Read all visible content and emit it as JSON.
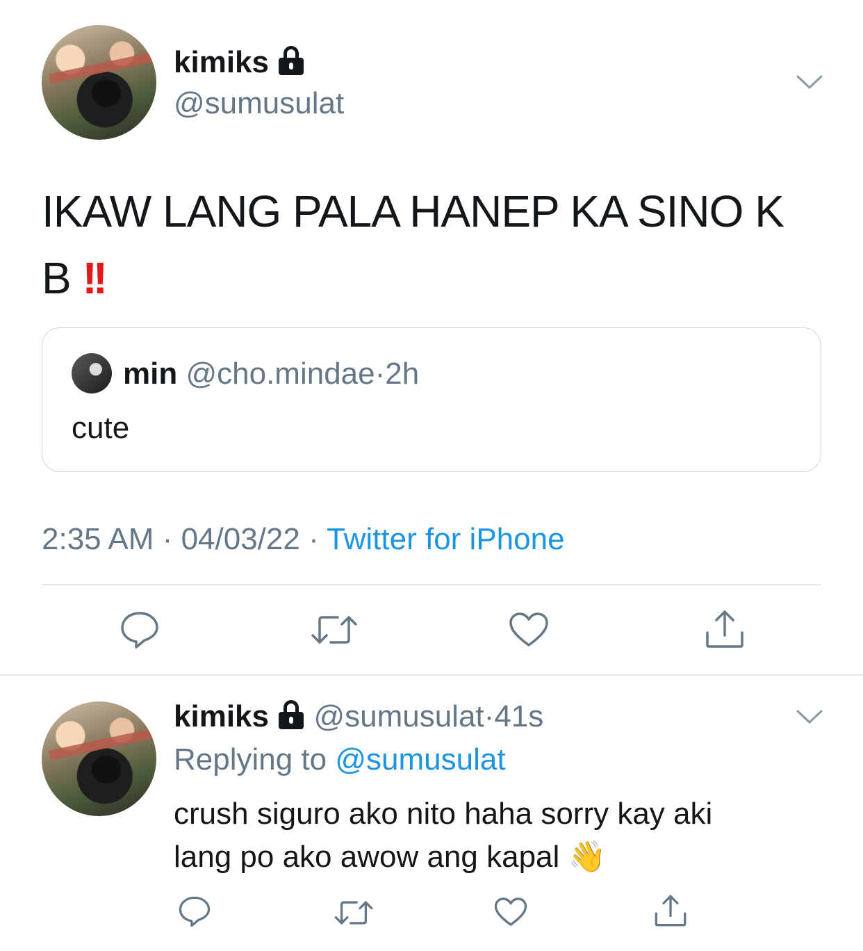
{
  "tweet": {
    "author_name": "kimiks",
    "author_handle": "@sumusulat",
    "text_line1": "IKAW LANG PALA HANEP KA SINO K",
    "text_line2": "B",
    "text_emoji": "!!",
    "quote": {
      "name": "min",
      "handle": "@cho.mindae",
      "dot": "·",
      "time": "2h",
      "text": "cute"
    },
    "meta": {
      "time": "2:35 AM",
      "dot1": "·",
      "date": "04/03/22",
      "dot2": "·",
      "source": "Twitter for iPhone"
    }
  },
  "reply": {
    "author_name": "kimiks",
    "author_handle": "@sumusulat",
    "dot": "·",
    "time": "41s",
    "replying_label": "Replying to",
    "replying_handle": "@sumusulat",
    "text_line1": "crush siguro ako nito haha sorry kay aki",
    "text_line2": "lang po ako awow ang kapal",
    "emoji": "👋"
  },
  "icons": {
    "reply": "reply-icon",
    "retweet": "retweet-icon",
    "like": "heart-icon",
    "share": "share-icon",
    "more": "chevron-down-icon",
    "protected": "lock-icon"
  },
  "colors": {
    "text": "#14171a",
    "secondary": "#657786",
    "link": "#1b95e0",
    "border": "#ccd6dd",
    "alert": "#e0191b"
  }
}
